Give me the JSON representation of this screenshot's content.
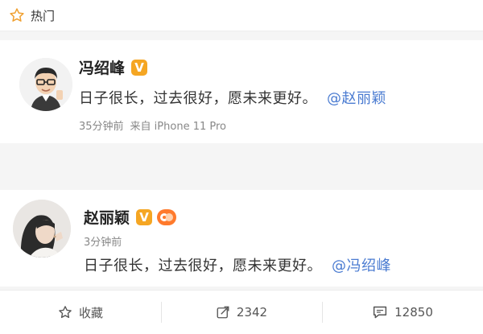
{
  "tab": {
    "label": "热门"
  },
  "posts": [
    {
      "author": "冯绍峰",
      "verified_label": "V",
      "text": "日子很长，过去很好，愿未来更好。",
      "mention": "@赵丽颖",
      "time": "35分钟前",
      "source": "来自 iPhone 11 Pro"
    },
    {
      "author": "赵丽颖",
      "verified_label": "V",
      "time": "3分钟前",
      "text": "日子很长，过去很好，愿未来更好。",
      "mention": "@冯绍峰"
    }
  ],
  "actions": {
    "favorite_label": "收藏",
    "repost_count": "2342",
    "comment_count": "12850"
  },
  "colors": {
    "mention": "#4a7bd1",
    "verified": "#f5a623",
    "fan_badge": "#ff7a2c"
  }
}
